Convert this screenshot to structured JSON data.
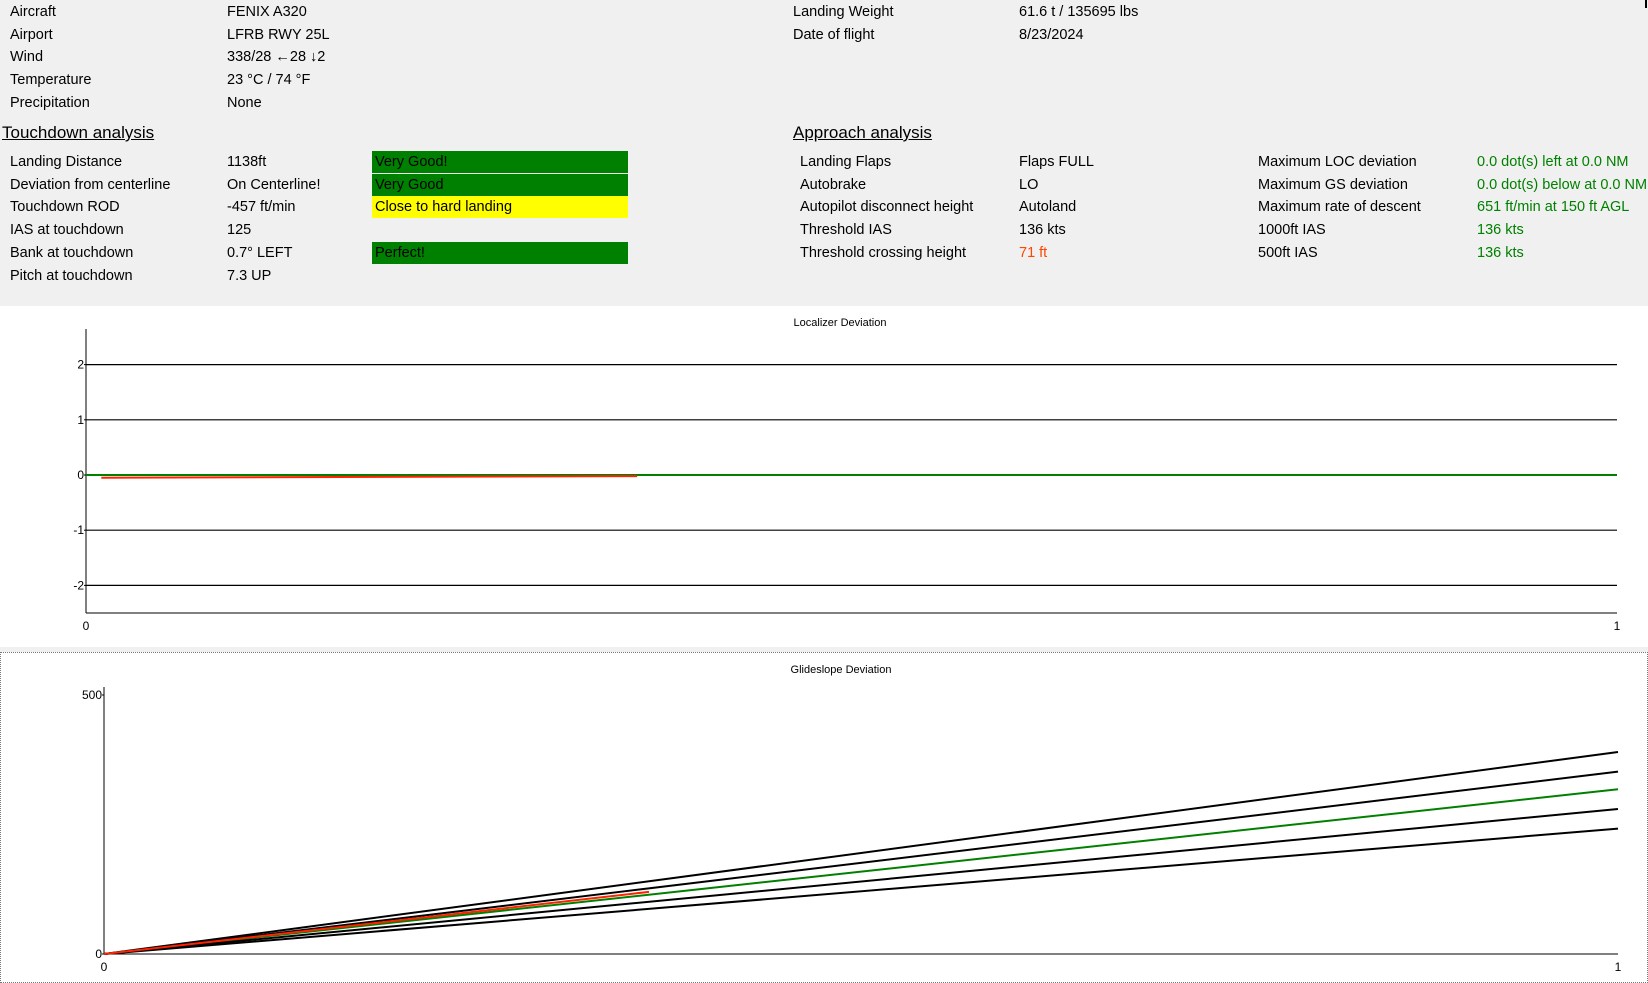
{
  "info": {
    "left": [
      {
        "label": "Aircraft",
        "value": "FENIX A320"
      },
      {
        "label": "Airport",
        "value": "LFRB RWY 25L"
      },
      {
        "label": "Wind",
        "value": "338/28  ←28 ↓2"
      },
      {
        "label": "Temperature",
        "value": "23 °C / 74 °F"
      },
      {
        "label": "Precipitation",
        "value": "None"
      }
    ],
    "right": [
      {
        "label": "Landing Weight",
        "value": "61.6 t / 135695 lbs"
      },
      {
        "label": "Date of flight",
        "value": "8/23/2024"
      }
    ]
  },
  "touchdown": {
    "title": "Touchdown analysis",
    "rows": [
      {
        "label": "Landing Distance",
        "value": "1138ft",
        "badge": "Very Good!",
        "badge_color": "#008000"
      },
      {
        "label": "Deviation from centerline",
        "value": "On Centerline!",
        "badge": "Very Good",
        "badge_color": "#008000"
      },
      {
        "label": "Touchdown ROD",
        "value": "-457 ft/min",
        "badge": "Close to hard landing",
        "badge_color": "#ffff00"
      },
      {
        "label": "IAS at touchdown",
        "value": "125",
        "badge": "",
        "badge_color": ""
      },
      {
        "label": "Bank at touchdown",
        "value": "0.7° LEFT",
        "badge": "Perfect!",
        "badge_color": "#008000"
      },
      {
        "label": "Pitch at touchdown",
        "value": "7.3 UP",
        "badge": "",
        "badge_color": ""
      }
    ]
  },
  "approach": {
    "title": "Approach analysis",
    "left_rows": [
      {
        "label": "Landing Flaps",
        "value": "Flaps FULL",
        "color": "#000000"
      },
      {
        "label": "Autobrake",
        "value": "LO",
        "color": "#000000"
      },
      {
        "label": "Autopilot disconnect height",
        "value": "Autoland",
        "color": "#000000"
      },
      {
        "label": "Threshold IAS",
        "value": "136 kts",
        "color": "#000000"
      },
      {
        "label": "Threshold crossing height",
        "value": "71 ft",
        "color": "#ff4500"
      }
    ],
    "right_rows": [
      {
        "label": "Maximum LOC deviation",
        "value": "0.0 dot(s) left at 0.0 NM",
        "color": "#008000"
      },
      {
        "label": "Maximum GS deviation",
        "value": "0.0 dot(s) below at 0.0 NM",
        "color": "#008000"
      },
      {
        "label": "Maximum rate of descent",
        "value": "651 ft/min at 150 ft AGL",
        "color": "#008000"
      },
      {
        "label": "1000ft IAS",
        "value": "136 kts",
        "color": "#008000"
      },
      {
        "label": "500ft IAS",
        "value": "136 kts",
        "color": "#008000"
      }
    ]
  },
  "chart_data": [
    {
      "type": "line",
      "title": "Localizer Deviation",
      "xlim": [
        0,
        1
      ],
      "ylim": [
        -2.5,
        2.5
      ],
      "x_ticks": [
        "0",
        "1"
      ],
      "y_ticks": [
        2,
        1,
        0,
        -1,
        -2
      ],
      "reference_lines": [
        2,
        1,
        0,
        -1,
        -2
      ],
      "series": [
        {
          "color": "#008000",
          "points": [
            [
              0,
              0
            ],
            [
              1,
              0
            ]
          ]
        },
        {
          "color": "#ff2200",
          "points": [
            [
              0.01,
              -0.05
            ],
            [
              0.36,
              -0.02
            ]
          ]
        }
      ]
    },
    {
      "type": "line",
      "title": "Glideslope Deviation",
      "xlim": [
        0,
        1
      ],
      "ylim": [
        0,
        500
      ],
      "x_ticks": [
        "0",
        "1"
      ],
      "y_ticks": [
        500,
        0
      ],
      "reference_lines": [
        {
          "color": "#000000",
          "points": [
            [
              0,
              0
            ],
            [
              1,
              390
            ]
          ]
        },
        {
          "color": "#000000",
          "points": [
            [
              0,
              0
            ],
            [
              1,
              352
            ]
          ]
        },
        {
          "color": "#008000",
          "points": [
            [
              0,
              0
            ],
            [
              1,
              318
            ]
          ]
        },
        {
          "color": "#000000",
          "points": [
            [
              0,
              0
            ],
            [
              1,
              280
            ]
          ]
        },
        {
          "color": "#000000",
          "points": [
            [
              0,
              0
            ],
            [
              1,
              242
            ]
          ]
        }
      ],
      "series": [
        {
          "color": "#ff2200",
          "points": [
            [
              0,
              0
            ],
            [
              0.36,
              120
            ]
          ]
        }
      ]
    }
  ]
}
